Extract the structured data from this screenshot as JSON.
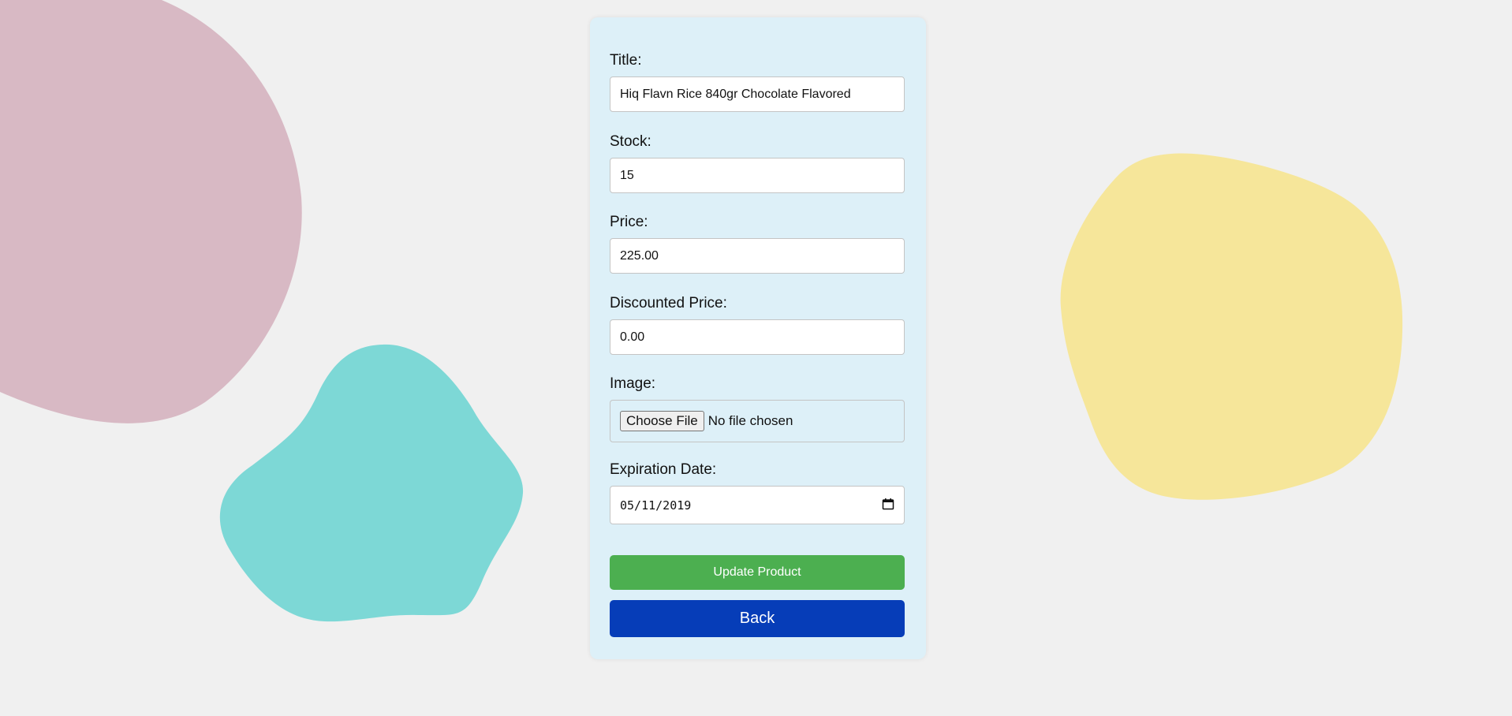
{
  "colors": {
    "background": "#f0f0f0",
    "card": "#ddf0f8",
    "update_button": "#4caf50",
    "back_button": "#063db8",
    "blob_pink": "#d8b9c4",
    "blob_teal": "#7dd8d6",
    "blob_yellow": "#f6e69a"
  },
  "form": {
    "title": {
      "label": "Title:",
      "value": "Hiq Flavn Rice 840gr Chocolate Flavored"
    },
    "stock": {
      "label": "Stock:",
      "value": "15"
    },
    "price": {
      "label": "Price:",
      "value": "225.00"
    },
    "discounted_price": {
      "label": "Discounted Price:",
      "value": "0.00"
    },
    "image": {
      "label": "Image:",
      "button_label": "Choose File",
      "status": "No file chosen"
    },
    "expiration_date": {
      "label": "Expiration Date:",
      "value": "05/11/2019",
      "icon": "calendar-icon"
    }
  },
  "actions": {
    "update_label": "Update Product",
    "back_label": "Back"
  }
}
